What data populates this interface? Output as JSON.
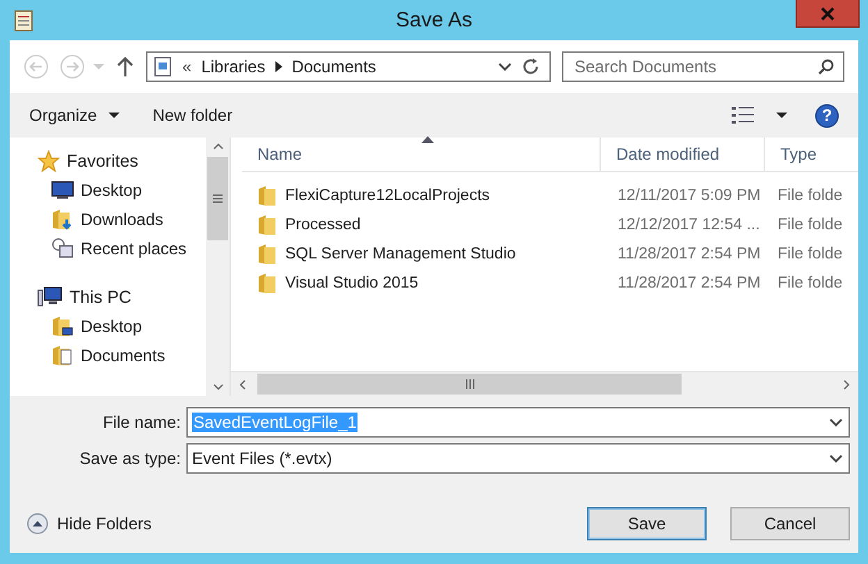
{
  "window": {
    "title": "Save As"
  },
  "address": {
    "overflow": "«",
    "path": [
      "Libraries",
      "Documents"
    ]
  },
  "search": {
    "placeholder": "Search Documents"
  },
  "toolbar": {
    "organize": "Organize",
    "new_folder": "New folder",
    "help": "?"
  },
  "nav": [
    {
      "label": "Favorites",
      "kind": "star",
      "children": [
        {
          "label": "Desktop",
          "kind": "desktop"
        },
        {
          "label": "Downloads",
          "kind": "downloads"
        },
        {
          "label": "Recent places",
          "kind": "recent"
        }
      ]
    },
    {
      "label": "This PC",
      "kind": "pc",
      "children": [
        {
          "label": "Desktop",
          "kind": "desktop-folder"
        },
        {
          "label": "Documents",
          "kind": "documents"
        }
      ]
    }
  ],
  "columns": [
    {
      "label": "Name",
      "sorted": true
    },
    {
      "label": "Date modified",
      "sorted": false
    },
    {
      "label": "Type",
      "sorted": false
    }
  ],
  "rows": [
    {
      "name": "FlexiCapture12LocalProjects",
      "date": "12/11/2017 5:09 PM",
      "type": "File folde"
    },
    {
      "name": "Processed",
      "date": "12/12/2017 12:54 ...",
      "type": "File folde"
    },
    {
      "name": "SQL Server Management Studio",
      "date": "11/28/2017 2:54 PM",
      "type": "File folde"
    },
    {
      "name": "Visual Studio 2015",
      "date": "11/28/2017 2:54 PM",
      "type": "File folde"
    }
  ],
  "file_name": {
    "label": "File name:",
    "value": "SavedEventLogFile_1",
    "text_selected": true
  },
  "save_type": {
    "label": "Save as type:",
    "value": "Event Files (*.evtx)"
  },
  "hide_folders": "Hide Folders",
  "buttons": [
    {
      "label": "Save",
      "default": true
    },
    {
      "label": "Cancel",
      "default": false
    }
  ]
}
